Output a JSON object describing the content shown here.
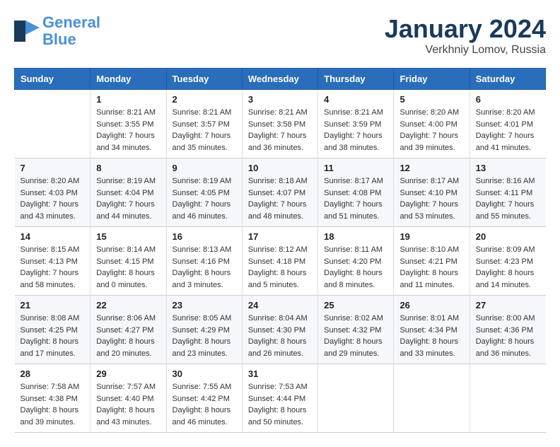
{
  "header": {
    "logo_line1": "General",
    "logo_line2": "Blue",
    "month": "January 2024",
    "location": "Verkhniy Lomov, Russia"
  },
  "days_of_week": [
    "Sunday",
    "Monday",
    "Tuesday",
    "Wednesday",
    "Thursday",
    "Friday",
    "Saturday"
  ],
  "weeks": [
    [
      {
        "day": "",
        "sunrise": "",
        "sunset": "",
        "daylight": ""
      },
      {
        "day": "1",
        "sunrise": "Sunrise: 8:21 AM",
        "sunset": "Sunset: 3:55 PM",
        "daylight": "Daylight: 7 hours and 34 minutes."
      },
      {
        "day": "2",
        "sunrise": "Sunrise: 8:21 AM",
        "sunset": "Sunset: 3:57 PM",
        "daylight": "Daylight: 7 hours and 35 minutes."
      },
      {
        "day": "3",
        "sunrise": "Sunrise: 8:21 AM",
        "sunset": "Sunset: 3:58 PM",
        "daylight": "Daylight: 7 hours and 36 minutes."
      },
      {
        "day": "4",
        "sunrise": "Sunrise: 8:21 AM",
        "sunset": "Sunset: 3:59 PM",
        "daylight": "Daylight: 7 hours and 38 minutes."
      },
      {
        "day": "5",
        "sunrise": "Sunrise: 8:20 AM",
        "sunset": "Sunset: 4:00 PM",
        "daylight": "Daylight: 7 hours and 39 minutes."
      },
      {
        "day": "6",
        "sunrise": "Sunrise: 8:20 AM",
        "sunset": "Sunset: 4:01 PM",
        "daylight": "Daylight: 7 hours and 41 minutes."
      }
    ],
    [
      {
        "day": "7",
        "sunrise": "Sunrise: 8:20 AM",
        "sunset": "Sunset: 4:03 PM",
        "daylight": "Daylight: 7 hours and 43 minutes."
      },
      {
        "day": "8",
        "sunrise": "Sunrise: 8:19 AM",
        "sunset": "Sunset: 4:04 PM",
        "daylight": "Daylight: 7 hours and 44 minutes."
      },
      {
        "day": "9",
        "sunrise": "Sunrise: 8:19 AM",
        "sunset": "Sunset: 4:05 PM",
        "daylight": "Daylight: 7 hours and 46 minutes."
      },
      {
        "day": "10",
        "sunrise": "Sunrise: 8:18 AM",
        "sunset": "Sunset: 4:07 PM",
        "daylight": "Daylight: 7 hours and 48 minutes."
      },
      {
        "day": "11",
        "sunrise": "Sunrise: 8:17 AM",
        "sunset": "Sunset: 4:08 PM",
        "daylight": "Daylight: 7 hours and 51 minutes."
      },
      {
        "day": "12",
        "sunrise": "Sunrise: 8:17 AM",
        "sunset": "Sunset: 4:10 PM",
        "daylight": "Daylight: 7 hours and 53 minutes."
      },
      {
        "day": "13",
        "sunrise": "Sunrise: 8:16 AM",
        "sunset": "Sunset: 4:11 PM",
        "daylight": "Daylight: 7 hours and 55 minutes."
      }
    ],
    [
      {
        "day": "14",
        "sunrise": "Sunrise: 8:15 AM",
        "sunset": "Sunset: 4:13 PM",
        "daylight": "Daylight: 7 hours and 58 minutes."
      },
      {
        "day": "15",
        "sunrise": "Sunrise: 8:14 AM",
        "sunset": "Sunset: 4:15 PM",
        "daylight": "Daylight: 8 hours and 0 minutes."
      },
      {
        "day": "16",
        "sunrise": "Sunrise: 8:13 AM",
        "sunset": "Sunset: 4:16 PM",
        "daylight": "Daylight: 8 hours and 3 minutes."
      },
      {
        "day": "17",
        "sunrise": "Sunrise: 8:12 AM",
        "sunset": "Sunset: 4:18 PM",
        "daylight": "Daylight: 8 hours and 5 minutes."
      },
      {
        "day": "18",
        "sunrise": "Sunrise: 8:11 AM",
        "sunset": "Sunset: 4:20 PM",
        "daylight": "Daylight: 8 hours and 8 minutes."
      },
      {
        "day": "19",
        "sunrise": "Sunrise: 8:10 AM",
        "sunset": "Sunset: 4:21 PM",
        "daylight": "Daylight: 8 hours and 11 minutes."
      },
      {
        "day": "20",
        "sunrise": "Sunrise: 8:09 AM",
        "sunset": "Sunset: 4:23 PM",
        "daylight": "Daylight: 8 hours and 14 minutes."
      }
    ],
    [
      {
        "day": "21",
        "sunrise": "Sunrise: 8:08 AM",
        "sunset": "Sunset: 4:25 PM",
        "daylight": "Daylight: 8 hours and 17 minutes."
      },
      {
        "day": "22",
        "sunrise": "Sunrise: 8:06 AM",
        "sunset": "Sunset: 4:27 PM",
        "daylight": "Daylight: 8 hours and 20 minutes."
      },
      {
        "day": "23",
        "sunrise": "Sunrise: 8:05 AM",
        "sunset": "Sunset: 4:29 PM",
        "daylight": "Daylight: 8 hours and 23 minutes."
      },
      {
        "day": "24",
        "sunrise": "Sunrise: 8:04 AM",
        "sunset": "Sunset: 4:30 PM",
        "daylight": "Daylight: 8 hours and 26 minutes."
      },
      {
        "day": "25",
        "sunrise": "Sunrise: 8:02 AM",
        "sunset": "Sunset: 4:32 PM",
        "daylight": "Daylight: 8 hours and 29 minutes."
      },
      {
        "day": "26",
        "sunrise": "Sunrise: 8:01 AM",
        "sunset": "Sunset: 4:34 PM",
        "daylight": "Daylight: 8 hours and 33 minutes."
      },
      {
        "day": "27",
        "sunrise": "Sunrise: 8:00 AM",
        "sunset": "Sunset: 4:36 PM",
        "daylight": "Daylight: 8 hours and 36 minutes."
      }
    ],
    [
      {
        "day": "28",
        "sunrise": "Sunrise: 7:58 AM",
        "sunset": "Sunset: 4:38 PM",
        "daylight": "Daylight: 8 hours and 39 minutes."
      },
      {
        "day": "29",
        "sunrise": "Sunrise: 7:57 AM",
        "sunset": "Sunset: 4:40 PM",
        "daylight": "Daylight: 8 hours and 43 minutes."
      },
      {
        "day": "30",
        "sunrise": "Sunrise: 7:55 AM",
        "sunset": "Sunset: 4:42 PM",
        "daylight": "Daylight: 8 hours and 46 minutes."
      },
      {
        "day": "31",
        "sunrise": "Sunrise: 7:53 AM",
        "sunset": "Sunset: 4:44 PM",
        "daylight": "Daylight: 8 hours and 50 minutes."
      },
      {
        "day": "",
        "sunrise": "",
        "sunset": "",
        "daylight": ""
      },
      {
        "day": "",
        "sunrise": "",
        "sunset": "",
        "daylight": ""
      },
      {
        "day": "",
        "sunrise": "",
        "sunset": "",
        "daylight": ""
      }
    ]
  ]
}
